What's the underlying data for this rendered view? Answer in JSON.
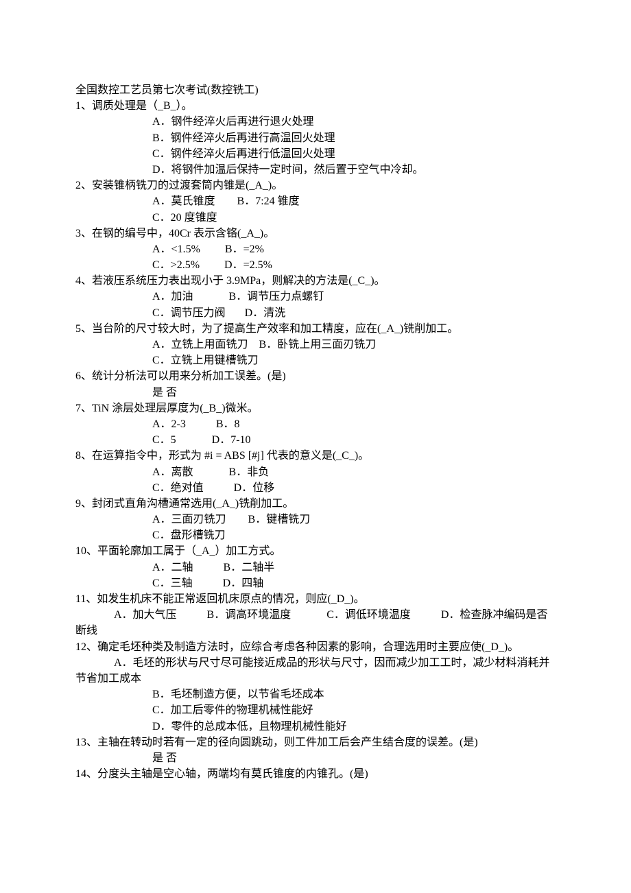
{
  "title": "全国数控工艺员第七次考试(数控铣工)",
  "q1": {
    "stem": "1、调质处理是（_B_）。",
    "a": "A．钢件经淬火后再进行退火处理",
    "b": "B．钢件经淬火后再进行高温回火处理",
    "c": "C．钢件经淬火后再进行低温回火处理",
    "d": "D．将钢件加温后保持一定时间，然后置于空气中冷却。"
  },
  "q2": {
    "stem": "2、安装锥柄铣刀的过渡套筒内锥是(_A_)。",
    "line1": "A．莫氏锥度        B．7:24 锥度",
    "line2": "C．20 度锥度"
  },
  "q3": {
    "stem": "3、在钢的编号中，40Cr 表示含铬(_A_)。",
    "line1": "A．<1.5%         B．=2%",
    "line2": "C．>2.5%         D．=2.5%"
  },
  "q4": {
    "stem": "4、若液压系统压力表出现小于 3.9MPa，则解决的方法是(_C_)。",
    "line1": "A．加油             B．调节压力点螺钉",
    "line2": "C．调节压力阀       D．清洗"
  },
  "q5": {
    "stem": "5、当台阶的尺寸较大时，为了提高生产效率和加工精度，应在(_A_)铣削加工。",
    "line1": "A．立铣上用面铣刀    B．卧铣上用三面刃铣刀",
    "line2": "C．立铣上用键槽铣刀"
  },
  "q6": {
    "stem": "6、统计分析法可以用来分析加工误差。(是)",
    "line1": "是 否"
  },
  "q7": {
    "stem": "7、TiN 涂层处理层厚度为(_B_)微米。",
    "line1": "A．2-3           B．8",
    "line2": "C．5             D．7-10"
  },
  "q8": {
    "stem": "8、在运算指令中，形式为 #i = ABS [#j] 代表的意义是(_C_)。",
    "line1": "A．离散             B．非负",
    "line2": "C．绝对值           D．位移"
  },
  "q9": {
    "stem": "9、封闭式直角沟槽通常选用(_A_)铣削加工。",
    "line1": "A．三面刃铣刀        B．键槽铣刀",
    "line2": "C．盘形槽铣刀"
  },
  "q10": {
    "stem": "10、平面轮廓加工属于（_A_）加工方式。",
    "line1": "A．二轴           B．二轴半",
    "line2": "C．三轴           D．四轴"
  },
  "q11": {
    "stem": "11、如发生机床不能正常返回机床原点的情况，则应(_D_)。",
    "line1": "              A．加大气压           B．调高环境温度             C．调低环境温度           D．检查脉冲编码是否断线"
  },
  "q12": {
    "stem": "12、确定毛坯种类及制造方法时，应综合考虑各种因素的影响，合理选用时主要应使(_D_)。",
    "a": "              A．毛坯的形状与尺寸尽可能接近成品的形状与尺寸，因而减少加工工时，减少材料消耗并节省加工成本",
    "b": "B．毛坯制造方便，以节省毛坯成本",
    "c": "C．加工后零件的物理机械性能好",
    "d": "D．零件的总成本低，且物理机械性能好"
  },
  "q13": {
    "stem": "13、主轴在转动时若有一定的径向圆跳动，则工件加工后会产生结合度的误差。(是)",
    "line1": "是 否"
  },
  "q14": {
    "stem": "14、分度头主轴是空心轴，两端均有莫氏锥度的内锥孔。(是)"
  }
}
